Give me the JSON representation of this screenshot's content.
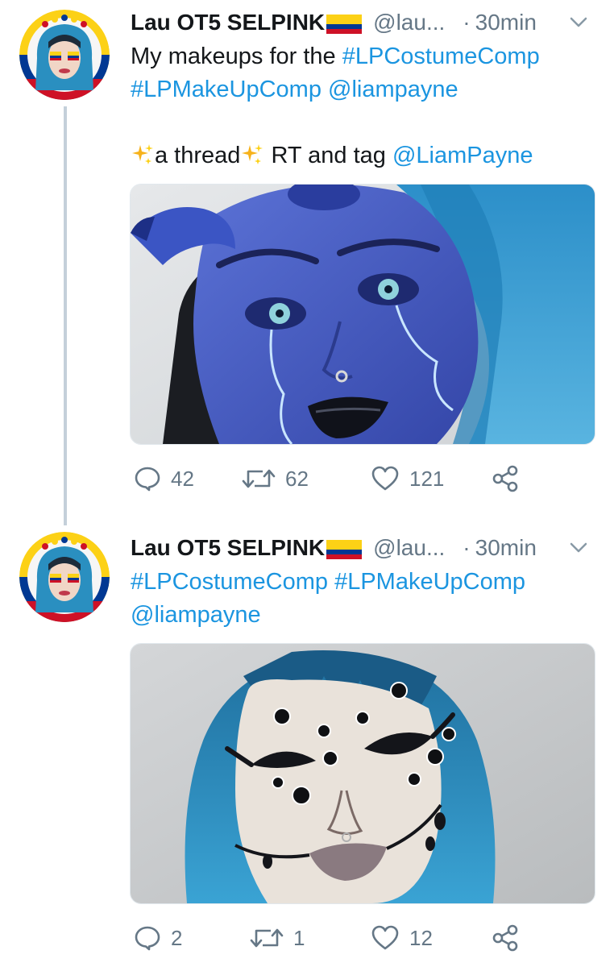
{
  "tweets": [
    {
      "name": "Lau OT5 SELPINK",
      "handle": "@lau...",
      "dot": "·",
      "time": "30min",
      "text": {
        "line1_plain": "My makeups for the ",
        "hashtag1": "#LPCostumeComp",
        "hashtag2": "#LPMakeUpComp",
        "mention1": "@liampayne",
        "line3_a": "a thread",
        "line3_b": " RT and tag ",
        "mention2": "@LiamPayne"
      },
      "media": {
        "description_icon": "blue-demon-makeup-photo"
      },
      "replies": "42",
      "retweets": "62",
      "likes": "121"
    },
    {
      "name": "Lau OT5 SELPINK",
      "handle": "@lau...",
      "dot": "·",
      "time": "30min",
      "text": {
        "hashtag1": "#LPCostumeComp",
        "hashtag2": "#LPMakeUpComp",
        "mention1": "@liampayne"
      },
      "media": {
        "description_icon": "multi-eye-spider-makeup-photo"
      },
      "replies": "2",
      "retweets": "1",
      "likes": "12"
    }
  ],
  "colors": {
    "link": "#1b95e0",
    "secondary_text": "#657786",
    "thread_line": "#c4d0da",
    "flag_yellow": "#fcd116",
    "flag_blue": "#003893",
    "flag_red": "#ce1126"
  }
}
